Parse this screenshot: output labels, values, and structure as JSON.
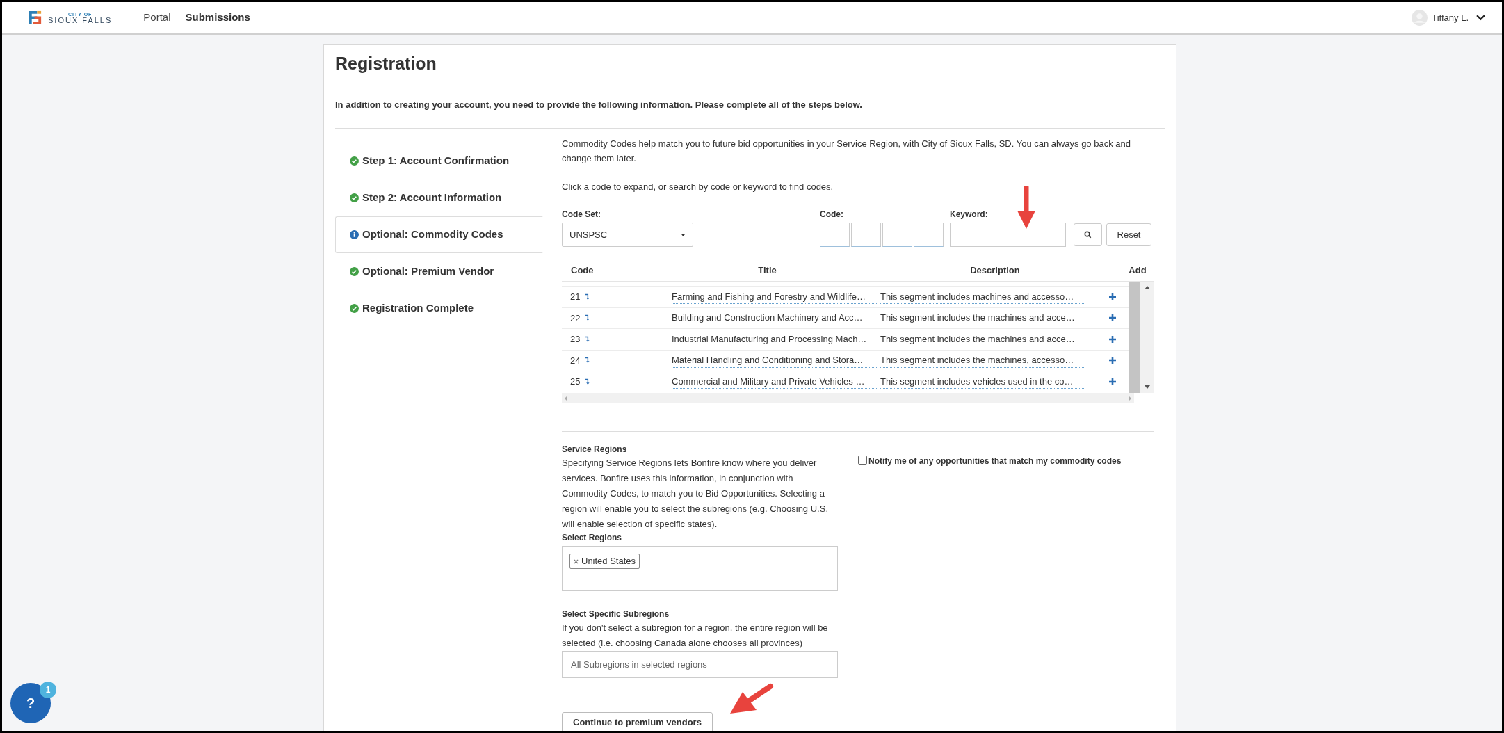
{
  "header": {
    "logo": {
      "line1": "CITY OF",
      "line2": "SIOUX FALLS"
    },
    "nav": [
      "Portal",
      "Submissions"
    ],
    "user": {
      "name": "Tiffany L."
    }
  },
  "registration": {
    "title": "Registration",
    "intro": "In addition to creating your account, you need to provide the following information. Please complete all of the steps below.",
    "steps": [
      {
        "label": "Step 1: Account Confirmation",
        "kind": "done",
        "selected": false
      },
      {
        "label": "Step 2: Account Information",
        "kind": "done",
        "selected": false
      },
      {
        "label": "Optional: Commodity Codes",
        "kind": "info",
        "selected": true
      },
      {
        "label": "Optional: Premium Vendor",
        "kind": "done",
        "selected": false
      },
      {
        "label": "Registration Complete",
        "kind": "done",
        "selected": false
      }
    ]
  },
  "commodity": {
    "intro": "Commodity Codes help match you to future bid opportunities in your Service Region, with City of Sioux Falls, SD. You can always go back and change them later.",
    "hint": "Click a code to expand, or search by code or keyword to find codes.",
    "code_set": {
      "label": "Code Set:",
      "value": "UNSPSC"
    },
    "code": {
      "label": "Code:"
    },
    "keyword": {
      "label": "Keyword:"
    },
    "reset": "Reset",
    "table": {
      "columns": [
        "Code",
        "Title",
        "Description",
        "Add"
      ],
      "rows": [
        {
          "code": "21",
          "title": "Farming and Fishing and Forestry and Wildlife…",
          "description": "This segment includes machines and accesso…"
        },
        {
          "code": "22",
          "title": "Building and Construction Machinery and Acc…",
          "description": "This segment includes the machines and acce…"
        },
        {
          "code": "23",
          "title": "Industrial Manufacturing and Processing Mach…",
          "description": "This segment includes the machines and acce…"
        },
        {
          "code": "24",
          "title": "Material Handling and Conditioning and Stora…",
          "description": "This segment includes the machines, accesso…"
        },
        {
          "code": "25",
          "title": "Commercial and Military and Private Vehicles …",
          "description": "This segment includes vehicles used in the co…"
        }
      ]
    }
  },
  "service_regions": {
    "title": "Service Regions",
    "description": "Specifying Service Regions lets Bonfire know where you deliver services. Bonfire uses this information, in conjunction with Commodity Codes, to match you to Bid Opportunities. Selecting a region will enable you to select the subregions (e.g. Choosing U.S. will enable selection of specific states).",
    "select_regions": {
      "label": "Select Regions",
      "tags": [
        "United States"
      ]
    },
    "subregions": {
      "label": "Select Specific Subregions",
      "help": "If you don't select a subregion for a region, the entire region will be selected (i.e. choosing Canada alone chooses all provinces)",
      "placeholder": "All Subregions in selected regions"
    },
    "notify": {
      "label": "Notify me of any opportunities that match my commodity codes",
      "checked": false
    },
    "continue": "Continue to premium vendors"
  },
  "help": {
    "label": "?",
    "badge": "1"
  }
}
